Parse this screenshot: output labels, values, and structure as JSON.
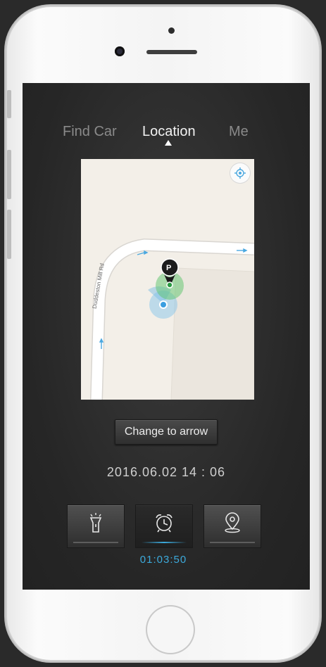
{
  "tabs": [
    {
      "label": "Find Car",
      "active": false
    },
    {
      "label": "Location",
      "active": true
    },
    {
      "label": "Me",
      "active": false
    }
  ],
  "map": {
    "road_label": "Duddeston Mill Rd",
    "locate_icon": "crosshair-icon",
    "car_marker_icon": "parking-car-pin-icon",
    "user_marker_icon": "user-location-dot-icon"
  },
  "actions": {
    "change_button_label": "Change to arrow"
  },
  "datetime": "2016.06.02  14 : 06",
  "toolbar": {
    "items": [
      {
        "icon": "flashlight-icon",
        "active": false
      },
      {
        "icon": "alarm-clock-icon",
        "active": true
      },
      {
        "icon": "location-pin-icon",
        "active": false
      }
    ]
  },
  "timer": "01:03:50",
  "colors": {
    "accent": "#3caadc",
    "screen_bg": "#2a2a2a",
    "map_bg": "#f3efe8",
    "car_marker": "#5cc46a"
  }
}
